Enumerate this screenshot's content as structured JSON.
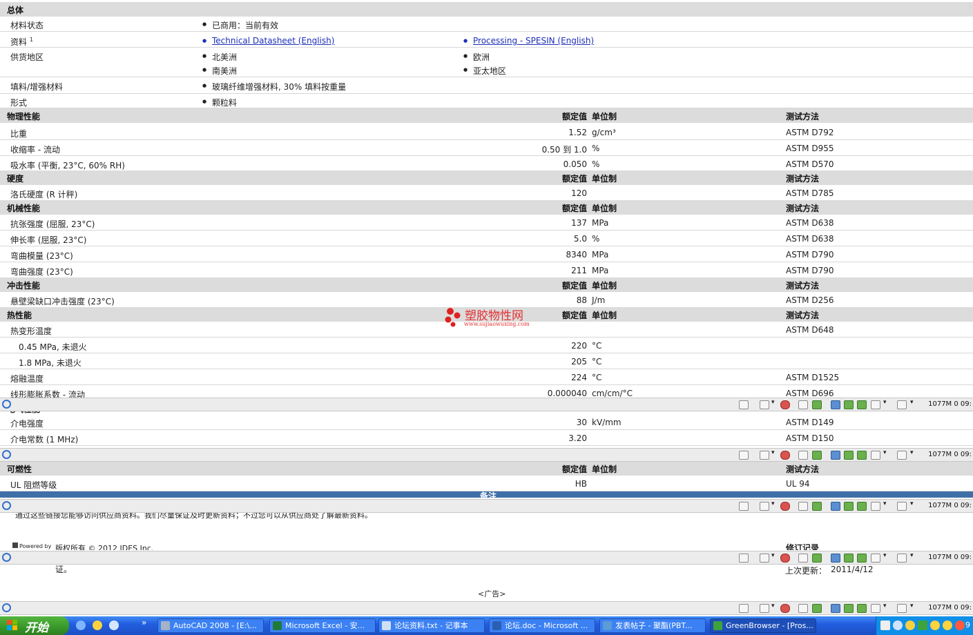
{
  "general": {
    "title": "总体",
    "rows": [
      {
        "label": "材料状态",
        "c1": [
          "已商用：当前有效"
        ],
        "c2": []
      },
      {
        "label": "资料",
        "sup": "1",
        "c1": [
          "Technical Datasheet (English)"
        ],
        "c2": [
          "Processing - SPESIN (English)"
        ]
      },
      {
        "label": "供货地区",
        "c1": [
          "北美洲",
          "南美洲"
        ],
        "c2": [
          "欧洲",
          "亚太地区"
        ]
      },
      {
        "label": "填料/增强材料",
        "c1": [
          "玻璃纤维增强材料, 30% 填料按重量"
        ],
        "c2": []
      },
      {
        "label": "形式",
        "c1": [
          "颗粒料"
        ],
        "c2": []
      }
    ]
  },
  "col_headers": {
    "value": "额定值",
    "unit": "单位制",
    "method": "测试方法"
  },
  "sections": [
    {
      "title": "物理性能",
      "rows": [
        {
          "label": "比重",
          "value": "1.52",
          "unit": "g/cm³",
          "method": "ASTM D792"
        },
        {
          "label": "收缩率 - 流动",
          "value": "0.50 到  1.0",
          "unit": "%",
          "method": "ASTM D955"
        },
        {
          "label": "吸水率 (平衡, 23°C, 60% RH)",
          "value": "0.050",
          "unit": "%",
          "method": "ASTM D570"
        }
      ]
    },
    {
      "title": "硬度",
      "rows": [
        {
          "label": "洛氏硬度 (R 计秤)",
          "value": "120",
          "unit": "",
          "method": "ASTM D785"
        }
      ]
    },
    {
      "title": "机械性能",
      "rows": [
        {
          "label": "抗张强度 (屈服, 23°C)",
          "value": "137",
          "unit": "MPa",
          "method": "ASTM D638"
        },
        {
          "label": "伸长率 (屈服, 23°C)",
          "value": "5.0",
          "unit": "%",
          "method": "ASTM D638"
        },
        {
          "label": "弯曲模量 (23°C)",
          "value": "8340",
          "unit": "MPa",
          "method": "ASTM D790"
        },
        {
          "label": "弯曲强度 (23°C)",
          "value": "211",
          "unit": "MPa",
          "method": "ASTM D790"
        }
      ]
    },
    {
      "title": "冲击性能",
      "rows": [
        {
          "label": "悬壁梁缺口冲击强度 (23°C)",
          "value": "88",
          "unit": "J/m",
          "method": "ASTM D256"
        }
      ]
    },
    {
      "title": "热性能",
      "rows": [
        {
          "label": "热变形温度",
          "value": "",
          "unit": "",
          "method": "ASTM D648"
        },
        {
          "label": "0.45 MPa, 未退火",
          "value": "220",
          "unit": "°C",
          "method": ""
        },
        {
          "label": "1.8 MPa, 未退火",
          "value": "205",
          "unit": "°C",
          "method": ""
        },
        {
          "label": "熔融温度",
          "value": "224",
          "unit": "°C",
          "method": "ASTM D1525"
        },
        {
          "label": "线形膨胀系数 - 流动",
          "value": "0.000040",
          "unit": "cm/cm/°C",
          "method": "ASTM D696"
        }
      ]
    }
  ],
  "electrical": {
    "rows": [
      {
        "label": "介电强度",
        "value": "30",
        "unit": "kV/mm",
        "method": "ASTM D149"
      },
      {
        "label": "介电常数 (1 MHz)",
        "value": "3.20",
        "unit": "",
        "method": "ASTM D150"
      }
    ]
  },
  "flammability": {
    "title": "可燃性",
    "rows": [
      {
        "label": "UL 阻燃等级",
        "value": "HB",
        "unit": "",
        "method": "UL 94"
      }
    ]
  },
  "notes": {
    "title": "备注",
    "text": "通过这些链接您能够访问供应商资料。我们尽量保证及时更新资料；不过您可以从供应商处了解最新资料。"
  },
  "footer": {
    "powered_by": "Powered by",
    "copyright": "版权所有 © 2012 IDES Inc.",
    "revision_title": "修订记录",
    "cert_fragment": "证。",
    "last_update_label": "上次更新：",
    "last_update_value": "2011/4/12",
    "ad": "<广告>"
  },
  "watermark": {
    "cn": "塑胶物性网",
    "url": "www.sujiaowuxing.com"
  },
  "statusbar": {
    "text": "1077M  0  09:"
  },
  "taskbar": {
    "start_label": "开始",
    "buttons": [
      {
        "label": "AutoCAD 2008 - [E:\\...",
        "icon": "autocad-icon"
      },
      {
        "label": "Microsoft Excel - 安...",
        "icon": "excel-icon"
      },
      {
        "label": "论坛资料.txt - 记事本",
        "icon": "notepad-icon"
      },
      {
        "label": "论坛.doc - Microsoft ...",
        "icon": "word-icon"
      },
      {
        "label": "发表帖子 - 聚酯(PBT...",
        "icon": "ie-icon"
      },
      {
        "label": "GreenBrowser - [Pros...",
        "icon": "greenbrowser-icon"
      }
    ],
    "clock": "9"
  },
  "colors": {
    "section_bg": "#dcdcdc",
    "link": "#1b2fb8",
    "notes_bar": "#3f6fa8",
    "taskbar": "#235ee0"
  }
}
